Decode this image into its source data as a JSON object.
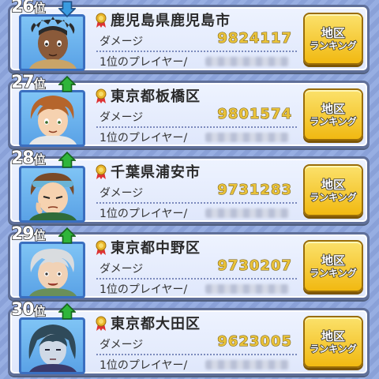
{
  "rank_suffix": "位",
  "damage_label": "ダメージ",
  "top_player_label": "1位のプレイヤー/",
  "button": {
    "line1": "地区",
    "line2": "ランキング"
  },
  "colors": {
    "up_arrow": "#2fb53a",
    "down_arrow": "#3a9be0",
    "button": "#f5c62a",
    "damage_value": "#e9c23a"
  },
  "entries": [
    {
      "rank": "26",
      "trend": "down",
      "trend_icon": "down-arrow-icon",
      "region": "鹿児島県鹿児島市",
      "damage": "9824117"
    },
    {
      "rank": "27",
      "trend": "up",
      "trend_icon": "up-arrow-icon",
      "region": "東京都板橋区",
      "damage": "9801574"
    },
    {
      "rank": "28",
      "trend": "up",
      "trend_icon": "up-arrow-icon",
      "region": "千葉県浦安市",
      "damage": "9731283"
    },
    {
      "rank": "29",
      "trend": "up",
      "trend_icon": "up-arrow-icon",
      "region": "東京都中野区",
      "damage": "9730207"
    },
    {
      "rank": "30",
      "trend": "up",
      "trend_icon": "up-arrow-icon",
      "region": "東京都大田区",
      "damage": "9623005"
    }
  ]
}
